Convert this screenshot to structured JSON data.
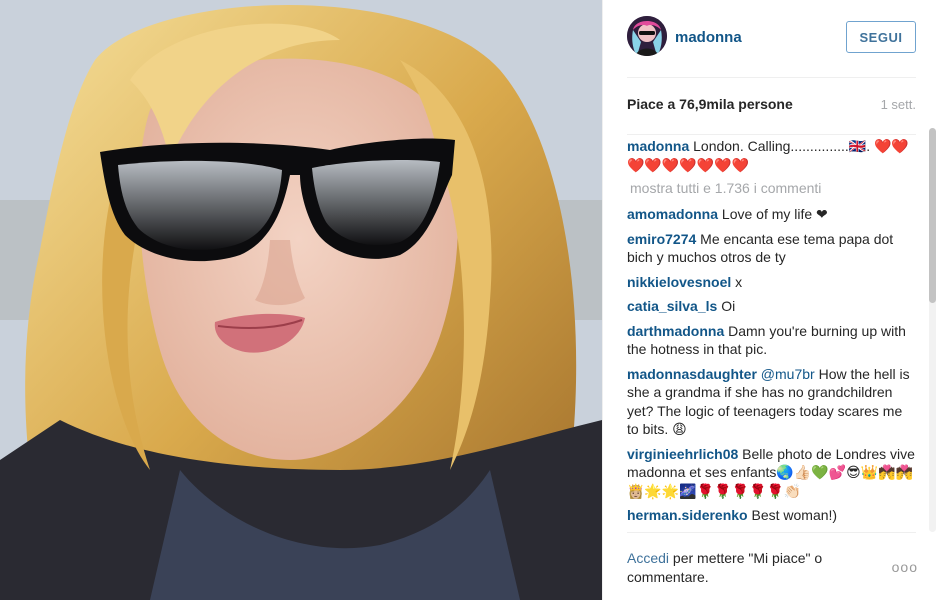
{
  "post": {
    "username": "madonna",
    "follow_label": "SEGUI",
    "likes": "Piace a 76,9mila persone",
    "age": "1 sett."
  },
  "caption": {
    "username": "madonna",
    "text": "London. Calling...............🇬🇧. ❤️❤️❤️❤️❤️❤️❤️❤️❤️"
  },
  "show_all": "mostra tutti e 1.736 i commenti",
  "comments": [
    {
      "username": "amomadonna",
      "text": "Love of my life ❤"
    },
    {
      "username": "emiro7274",
      "text": "Me encanta ese tema papa dot bich y muchos otros de ty"
    },
    {
      "username": "nikkielovesnoel",
      "text": "x"
    },
    {
      "username": "catia_silva_ls",
      "text": "Oi"
    },
    {
      "username": "darthmadonna",
      "text": "Damn you're burning up with the hotness in that pic."
    },
    {
      "username": "madonnasdaughter",
      "mention": "@mu7br",
      "text": "How the hell is she a grandma if she has no grandchildren yet? The logic of teenagers today scares me to bits. 😩"
    },
    {
      "username": "virginieehrlich08",
      "text": "Belle photo de Londres vive madonna et ses enfants🌏👍🏻💚💕😎👑💏💏👸🏼🌟🌟🌌🌹🌹🌹🌹🌹👏🏻"
    },
    {
      "username": "herman.siderenko",
      "text": "Best woman!)"
    }
  ],
  "footer": {
    "login": "Accedi",
    "rest": " per mettere \"Mi piace\" o commentare.",
    "more_label": "ooo"
  },
  "icons": {
    "more": "more-options-icon"
  }
}
